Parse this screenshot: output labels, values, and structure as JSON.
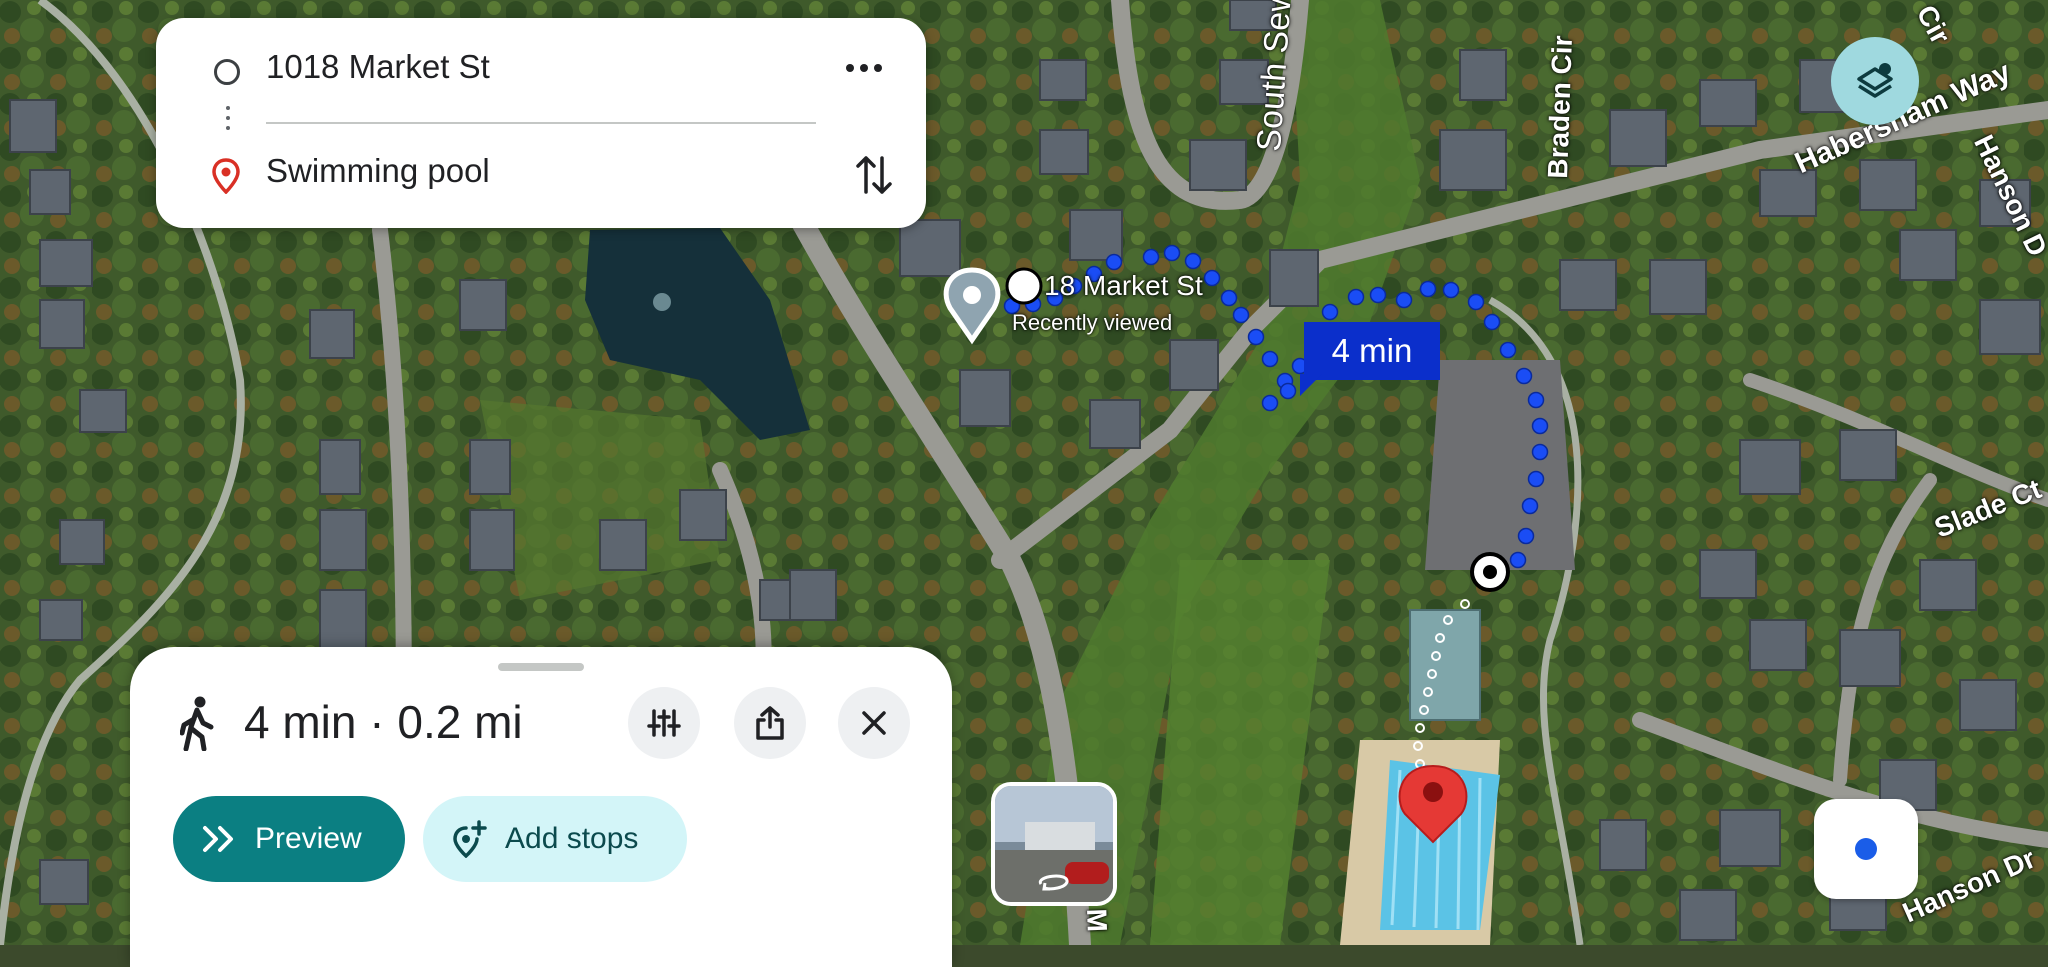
{
  "origin": {
    "value": "1018 Market St"
  },
  "destination": {
    "value": "Swimming pool"
  },
  "map": {
    "place_name": "18 Market St",
    "place_subtitle": "Recently viewed",
    "route_time": "4 min",
    "streets": [
      "South Seward Hills",
      "Braden Cir",
      "Habersham Way",
      "Hanson D",
      "Slade Ct",
      "Hanson Dr",
      "Cir",
      "M"
    ]
  },
  "sheet": {
    "summary": "4 min · 0.2 mi",
    "preview_label": "Preview",
    "add_stops_label": "Add stops"
  },
  "colors": {
    "accent": "#0b7f82",
    "chip_bg": "#d3f5f8",
    "route": "#1a4df5",
    "pin": "#e53935",
    "location_dot": "#1a5de8"
  },
  "icons": [
    "more-icon",
    "swap-icon",
    "walk-icon",
    "route-options-icon",
    "share-icon",
    "close-icon",
    "preview-icon",
    "add-stop-icon",
    "layers-icon",
    "my-location-icon",
    "street-view-icon"
  ]
}
